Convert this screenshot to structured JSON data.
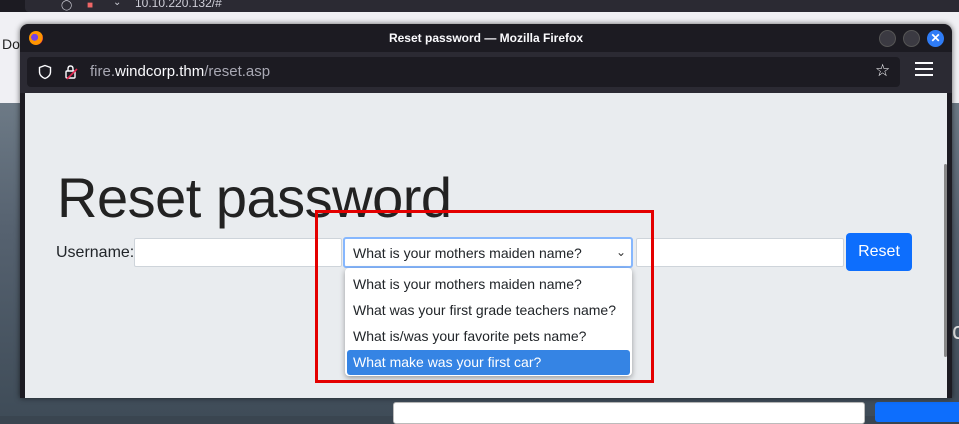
{
  "background": {
    "tab_text": "Do",
    "url_text": "10.10.220.132/#"
  },
  "window": {
    "title": "Reset password — Mozilla Firefox",
    "close_glyph": "✕"
  },
  "toolbar": {
    "url_host_prefix": "fire.",
    "url_domain": "windcorp.thm",
    "url_path": "/reset.asp",
    "icons": [
      "shield-icon",
      "lock-icon",
      "star-icon",
      "hamburger-menu-icon"
    ]
  },
  "page": {
    "heading": "Reset password",
    "username_label": "Username:",
    "username_value": "",
    "question_selected": "What is your mothers maiden name?",
    "answer_value": "",
    "reset_button": "Reset",
    "dropdown_options": [
      "What is your mothers maiden name?",
      "What was your first grade teachers name?",
      "What is/was your favorite pets name?",
      "What make was your first car?"
    ],
    "highlighted_option_index": 3
  },
  "colors": {
    "primary": "#0d6efd",
    "highlight_border": "#e40000",
    "selected_option": "#3584e4"
  }
}
